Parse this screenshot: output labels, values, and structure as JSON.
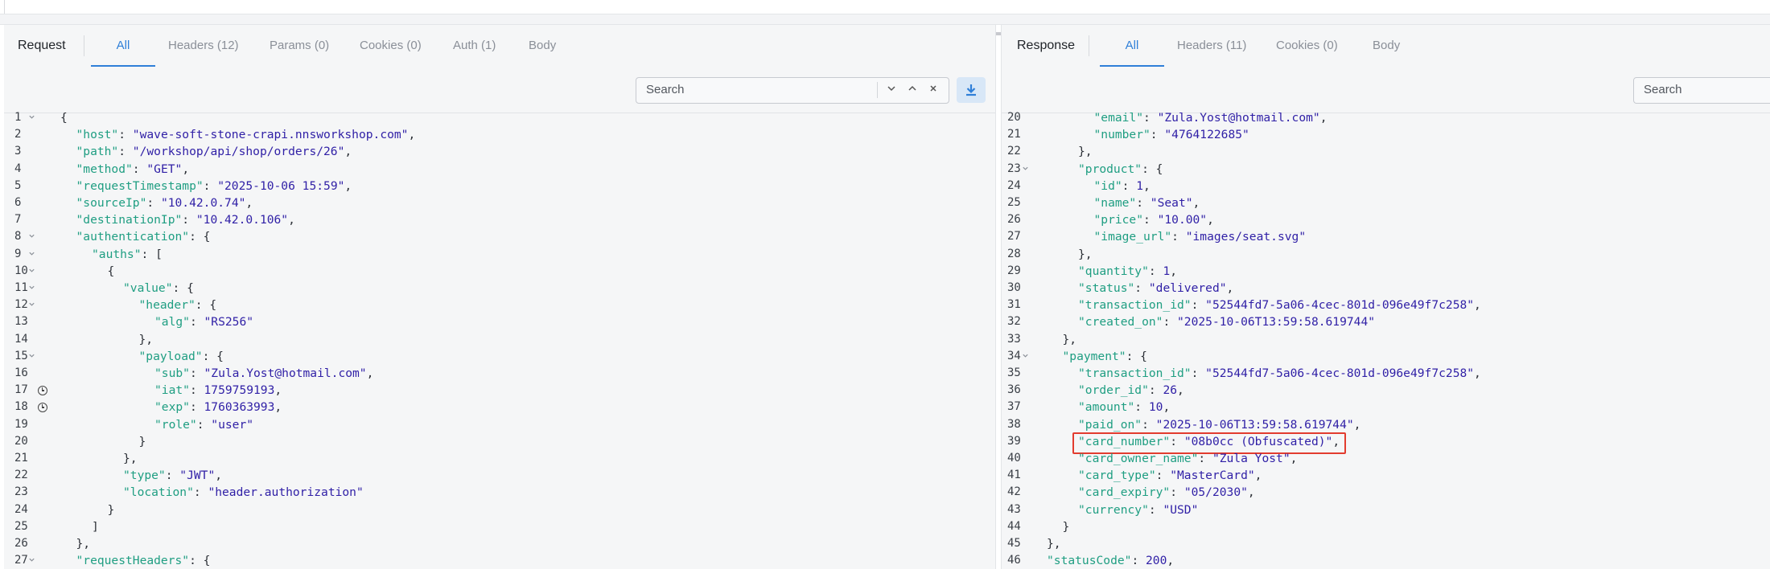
{
  "request": {
    "title": "Request",
    "tabs": [
      "All",
      "Headers (12)",
      "Params (0)",
      "Cookies (0)",
      "Auth (1)",
      "Body"
    ],
    "active_tab": "All",
    "search_placeholder": "Search"
  },
  "response": {
    "title": "Response",
    "tabs": [
      "All",
      "Headers (11)",
      "Cookies (0)",
      "Body"
    ],
    "active_tab": "All",
    "search_placeholder": "Search"
  },
  "request_lines": [
    {
      "n": "1",
      "fold": true,
      "indent": 0,
      "parts": [
        [
          "p",
          "{"
        ]
      ]
    },
    {
      "n": "2",
      "indent": 1,
      "parts": [
        [
          "k",
          "\"host\""
        ],
        [
          "p",
          ": "
        ],
        [
          "s",
          "\"wave-soft-stone-crapi.nnsworkshop.com\""
        ],
        [
          "p",
          ","
        ]
      ]
    },
    {
      "n": "3",
      "indent": 1,
      "parts": [
        [
          "k",
          "\"path\""
        ],
        [
          "p",
          ": "
        ],
        [
          "s",
          "\"/workshop/api/shop/orders/26\""
        ],
        [
          "p",
          ","
        ]
      ]
    },
    {
      "n": "4",
      "indent": 1,
      "parts": [
        [
          "k",
          "\"method\""
        ],
        [
          "p",
          ": "
        ],
        [
          "s",
          "\"GET\""
        ],
        [
          "p",
          ","
        ]
      ]
    },
    {
      "n": "5",
      "indent": 1,
      "parts": [
        [
          "k",
          "\"requestTimestamp\""
        ],
        [
          "p",
          ": "
        ],
        [
          "s",
          "\"2025-10-06 15:59\""
        ],
        [
          "p",
          ","
        ]
      ]
    },
    {
      "n": "6",
      "indent": 1,
      "parts": [
        [
          "k",
          "\"sourceIp\""
        ],
        [
          "p",
          ": "
        ],
        [
          "s",
          "\"10.42.0.74\""
        ],
        [
          "p",
          ","
        ]
      ]
    },
    {
      "n": "7",
      "indent": 1,
      "parts": [
        [
          "k",
          "\"destinationIp\""
        ],
        [
          "p",
          ": "
        ],
        [
          "s",
          "\"10.42.0.106\""
        ],
        [
          "p",
          ","
        ]
      ]
    },
    {
      "n": "8",
      "fold": true,
      "indent": 1,
      "parts": [
        [
          "k",
          "\"authentication\""
        ],
        [
          "p",
          ": {"
        ]
      ]
    },
    {
      "n": "9",
      "fold": true,
      "indent": 2,
      "parts": [
        [
          "k",
          "\"auths\""
        ],
        [
          "p",
          ": ["
        ]
      ]
    },
    {
      "n": "10",
      "fold": true,
      "indent": 3,
      "parts": [
        [
          "p",
          "{"
        ]
      ]
    },
    {
      "n": "11",
      "fold": true,
      "indent": 4,
      "parts": [
        [
          "k",
          "\"value\""
        ],
        [
          "p",
          ": {"
        ]
      ]
    },
    {
      "n": "12",
      "fold": true,
      "indent": 5,
      "parts": [
        [
          "k",
          "\"header\""
        ],
        [
          "p",
          ": {"
        ]
      ]
    },
    {
      "n": "13",
      "indent": 6,
      "parts": [
        [
          "k",
          "\"alg\""
        ],
        [
          "p",
          ": "
        ],
        [
          "s",
          "\"RS256\""
        ]
      ]
    },
    {
      "n": "14",
      "indent": 5,
      "parts": [
        [
          "p",
          "},"
        ]
      ]
    },
    {
      "n": "15",
      "fold": true,
      "indent": 5,
      "parts": [
        [
          "k",
          "\"payload\""
        ],
        [
          "p",
          ": {"
        ]
      ]
    },
    {
      "n": "16",
      "indent": 6,
      "parts": [
        [
          "k",
          "\"sub\""
        ],
        [
          "p",
          ": "
        ],
        [
          "s",
          "\"Zula.Yost@hotmail.com\""
        ],
        [
          "p",
          ","
        ]
      ]
    },
    {
      "n": "17",
      "clock": true,
      "indent": 6,
      "parts": [
        [
          "k",
          "\"iat\""
        ],
        [
          "p",
          ": "
        ],
        [
          "n",
          "1759759193"
        ],
        [
          "p",
          ","
        ]
      ]
    },
    {
      "n": "18",
      "clock": true,
      "indent": 6,
      "parts": [
        [
          "k",
          "\"exp\""
        ],
        [
          "p",
          ": "
        ],
        [
          "n",
          "1760363993"
        ],
        [
          "p",
          ","
        ]
      ]
    },
    {
      "n": "19",
      "indent": 6,
      "parts": [
        [
          "k",
          "\"role\""
        ],
        [
          "p",
          ": "
        ],
        [
          "s",
          "\"user\""
        ]
      ]
    },
    {
      "n": "20",
      "indent": 5,
      "parts": [
        [
          "p",
          "}"
        ]
      ]
    },
    {
      "n": "21",
      "indent": 4,
      "parts": [
        [
          "p",
          "},"
        ]
      ]
    },
    {
      "n": "22",
      "indent": 4,
      "parts": [
        [
          "k",
          "\"type\""
        ],
        [
          "p",
          ": "
        ],
        [
          "s",
          "\"JWT\""
        ],
        [
          "p",
          ","
        ]
      ]
    },
    {
      "n": "23",
      "indent": 4,
      "parts": [
        [
          "k",
          "\"location\""
        ],
        [
          "p",
          ": "
        ],
        [
          "s",
          "\"header.authorization\""
        ]
      ]
    },
    {
      "n": "24",
      "indent": 3,
      "parts": [
        [
          "p",
          "}"
        ]
      ]
    },
    {
      "n": "25",
      "indent": 2,
      "parts": [
        [
          "p",
          "]"
        ]
      ]
    },
    {
      "n": "26",
      "indent": 1,
      "parts": [
        [
          "p",
          "},"
        ]
      ]
    },
    {
      "n": "27",
      "fold": true,
      "indent": 1,
      "parts": [
        [
          "k",
          "\"requestHeaders\""
        ],
        [
          "p",
          ": {"
        ]
      ]
    }
  ],
  "response_lines": [
    {
      "n": "20",
      "indent": 3,
      "parts": [
        [
          "k",
          "\"email\""
        ],
        [
          "p",
          ": "
        ],
        [
          "s",
          "\"Zula.Yost@hotmail.com\""
        ],
        [
          "p",
          ","
        ]
      ]
    },
    {
      "n": "21",
      "indent": 3,
      "parts": [
        [
          "k",
          "\"number\""
        ],
        [
          "p",
          ": "
        ],
        [
          "s",
          "\"4764122685\""
        ]
      ]
    },
    {
      "n": "22",
      "indent": 2,
      "parts": [
        [
          "p",
          "},"
        ]
      ]
    },
    {
      "n": "23",
      "fold": true,
      "indent": 2,
      "parts": [
        [
          "k",
          "\"product\""
        ],
        [
          "p",
          ": {"
        ]
      ]
    },
    {
      "n": "24",
      "indent": 3,
      "parts": [
        [
          "k",
          "\"id\""
        ],
        [
          "p",
          ": "
        ],
        [
          "n",
          "1"
        ],
        [
          "p",
          ","
        ]
      ]
    },
    {
      "n": "25",
      "indent": 3,
      "parts": [
        [
          "k",
          "\"name\""
        ],
        [
          "p",
          ": "
        ],
        [
          "s",
          "\"Seat\""
        ],
        [
          "p",
          ","
        ]
      ]
    },
    {
      "n": "26",
      "indent": 3,
      "parts": [
        [
          "k",
          "\"price\""
        ],
        [
          "p",
          ": "
        ],
        [
          "s",
          "\"10.00\""
        ],
        [
          "p",
          ","
        ]
      ]
    },
    {
      "n": "27",
      "indent": 3,
      "parts": [
        [
          "k",
          "\"image_url\""
        ],
        [
          "p",
          ": "
        ],
        [
          "s",
          "\"images/seat.svg\""
        ]
      ]
    },
    {
      "n": "28",
      "indent": 2,
      "parts": [
        [
          "p",
          "},"
        ]
      ]
    },
    {
      "n": "29",
      "indent": 2,
      "parts": [
        [
          "k",
          "\"quantity\""
        ],
        [
          "p",
          ": "
        ],
        [
          "n",
          "1"
        ],
        [
          "p",
          ","
        ]
      ]
    },
    {
      "n": "30",
      "indent": 2,
      "parts": [
        [
          "k",
          "\"status\""
        ],
        [
          "p",
          ": "
        ],
        [
          "s",
          "\"delivered\""
        ],
        [
          "p",
          ","
        ]
      ]
    },
    {
      "n": "31",
      "indent": 2,
      "parts": [
        [
          "k",
          "\"transaction_id\""
        ],
        [
          "p",
          ": "
        ],
        [
          "s",
          "\"52544fd7-5a06-4cec-801d-096e49f7c258\""
        ],
        [
          "p",
          ","
        ]
      ]
    },
    {
      "n": "32",
      "indent": 2,
      "parts": [
        [
          "k",
          "\"created_on\""
        ],
        [
          "p",
          ": "
        ],
        [
          "s",
          "\"2025-10-06T13:59:58.619744\""
        ]
      ]
    },
    {
      "n": "33",
      "indent": 1,
      "parts": [
        [
          "p",
          "},"
        ]
      ]
    },
    {
      "n": "34",
      "fold": true,
      "indent": 1,
      "parts": [
        [
          "k",
          "\"payment\""
        ],
        [
          "p",
          ": {"
        ]
      ]
    },
    {
      "n": "35",
      "indent": 2,
      "parts": [
        [
          "k",
          "\"transaction_id\""
        ],
        [
          "p",
          ": "
        ],
        [
          "s",
          "\"52544fd7-5a06-4cec-801d-096e49f7c258\""
        ],
        [
          "p",
          ","
        ]
      ]
    },
    {
      "n": "36",
      "indent": 2,
      "parts": [
        [
          "k",
          "\"order_id\""
        ],
        [
          "p",
          ": "
        ],
        [
          "n",
          "26"
        ],
        [
          "p",
          ","
        ]
      ]
    },
    {
      "n": "37",
      "indent": 2,
      "parts": [
        [
          "k",
          "\"amount\""
        ],
        [
          "p",
          ": "
        ],
        [
          "n",
          "10"
        ],
        [
          "p",
          ","
        ]
      ]
    },
    {
      "n": "38",
      "indent": 2,
      "parts": [
        [
          "k",
          "\"paid_on\""
        ],
        [
          "p",
          ": "
        ],
        [
          "s",
          "\"2025-10-06T13:59:58.619744\""
        ],
        [
          "p",
          ","
        ]
      ]
    },
    {
      "n": "39",
      "highlight": true,
      "indent": 2,
      "parts": [
        [
          "k",
          "\"card_number\""
        ],
        [
          "p",
          ": "
        ],
        [
          "s",
          "\"08b0cc (Obfuscated)\""
        ],
        [
          "p",
          ","
        ]
      ]
    },
    {
      "n": "40",
      "indent": 2,
      "parts": [
        [
          "k",
          "\"card_owner_name\""
        ],
        [
          "p",
          ": "
        ],
        [
          "s",
          "\"Zula Yost\""
        ],
        [
          "p",
          ","
        ]
      ]
    },
    {
      "n": "41",
      "indent": 2,
      "parts": [
        [
          "k",
          "\"card_type\""
        ],
        [
          "p",
          ": "
        ],
        [
          "s",
          "\"MasterCard\""
        ],
        [
          "p",
          ","
        ]
      ]
    },
    {
      "n": "42",
      "indent": 2,
      "parts": [
        [
          "k",
          "\"card_expiry\""
        ],
        [
          "p",
          ": "
        ],
        [
          "s",
          "\"05/2030\""
        ],
        [
          "p",
          ","
        ]
      ]
    },
    {
      "n": "43",
      "indent": 2,
      "parts": [
        [
          "k",
          "\"currency\""
        ],
        [
          "p",
          ": "
        ],
        [
          "s",
          "\"USD\""
        ]
      ]
    },
    {
      "n": "44",
      "indent": 1,
      "parts": [
        [
          "p",
          "}"
        ]
      ]
    },
    {
      "n": "45",
      "indent": 0,
      "parts": [
        [
          "p",
          "},"
        ]
      ]
    },
    {
      "n": "46",
      "indent": 0,
      "parts": [
        [
          "k",
          "\"statusCode\""
        ],
        [
          "p",
          ": "
        ],
        [
          "n",
          "200"
        ],
        [
          "p",
          ","
        ]
      ]
    }
  ]
}
